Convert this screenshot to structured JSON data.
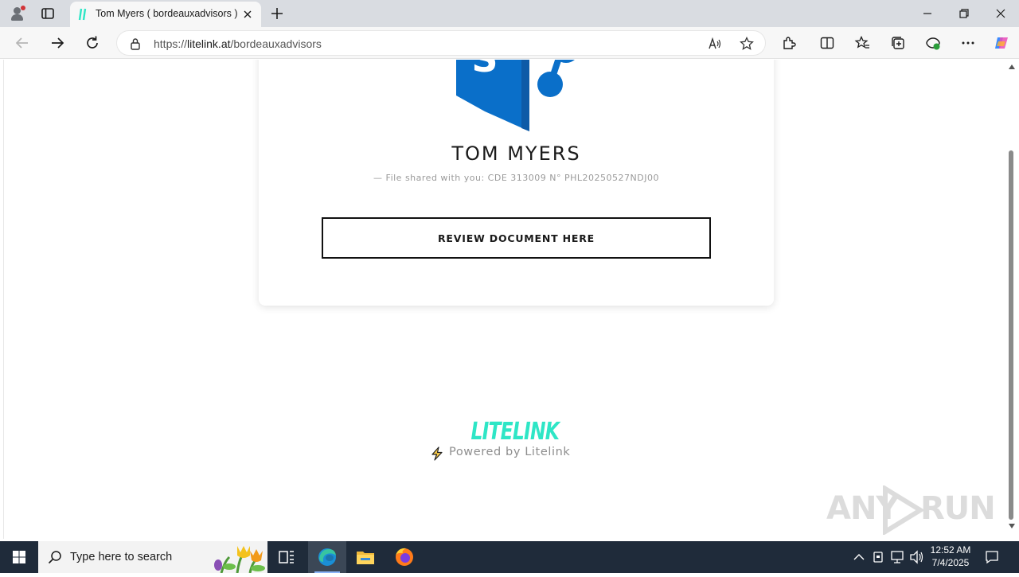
{
  "browser": {
    "tab_title": "Tom Myers ( bordeauxadvisors ) -",
    "url_prefix": "https://",
    "url_host": "litelink.at",
    "url_path": "/bordeauxadvisors"
  },
  "page": {
    "name": "TOM MYERS",
    "subtitle": "— File shared with you: CDE 313009 N° PHL20250527NDJ00",
    "cta_label": "REVIEW DOCUMENT HERE",
    "brand": "LITELINK",
    "powered_by": "Powered by Litelink",
    "accent_color": "#2ee6c6",
    "logo_color": "#0a6fc9"
  },
  "watermark": {
    "left": "ANY",
    "right": "RUN"
  },
  "taskbar": {
    "search_placeholder": "Type here to search",
    "time": "12:52 AM",
    "date": "7/4/2025"
  }
}
